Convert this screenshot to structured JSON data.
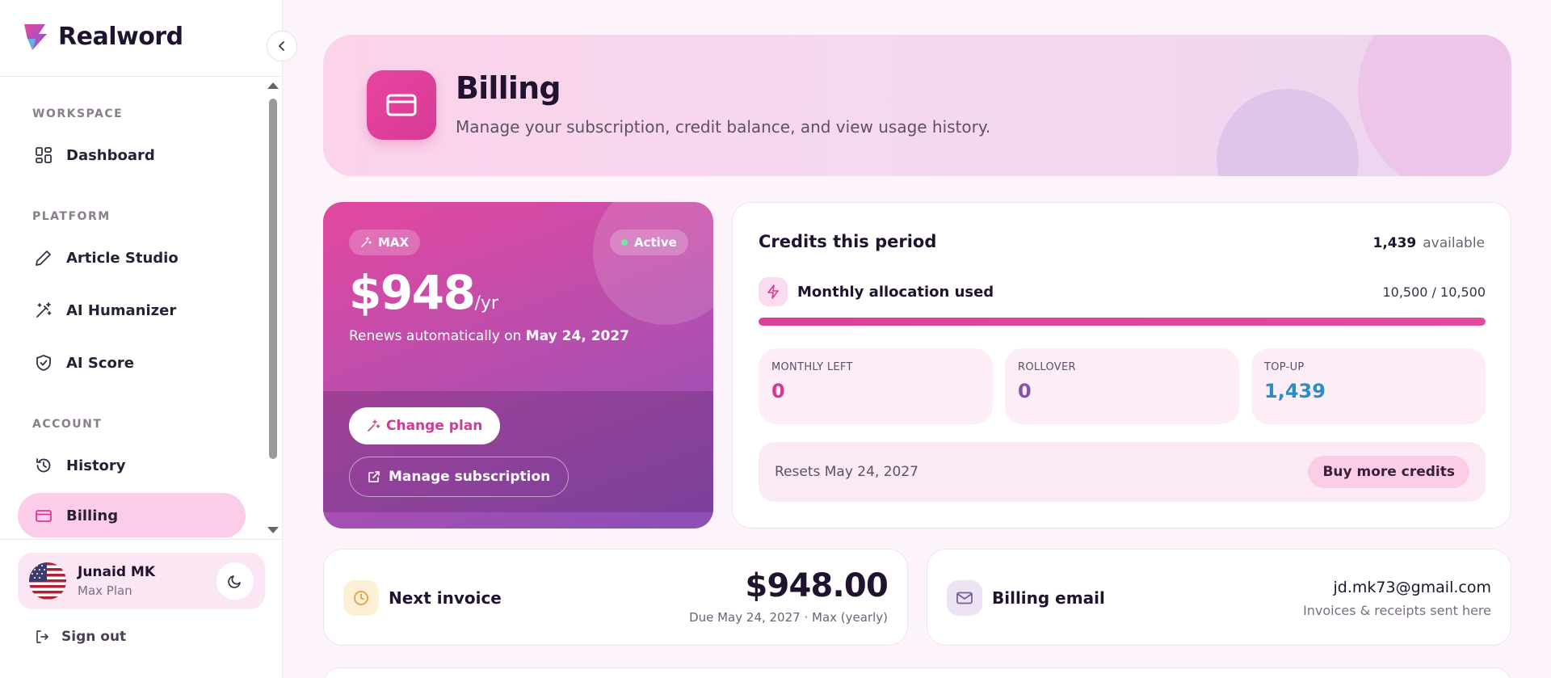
{
  "brand": {
    "name": "Realword"
  },
  "sidebar": {
    "sections": [
      {
        "label": "WORKSPACE"
      },
      {
        "label": "PLATFORM"
      },
      {
        "label": "ACCOUNT"
      }
    ],
    "items": [
      {
        "label": "Dashboard",
        "icon": "grid-icon",
        "active": false
      },
      {
        "label": "Article Studio",
        "icon": "pen-icon",
        "active": false
      },
      {
        "label": "AI Humanizer",
        "icon": "magic-wand-icon",
        "active": false
      },
      {
        "label": "AI Score",
        "icon": "shield-check-icon",
        "active": false
      },
      {
        "label": "History",
        "icon": "history-icon",
        "active": false
      },
      {
        "label": "Billing",
        "icon": "credit-card-icon",
        "active": true
      }
    ],
    "user": {
      "name": "Junaid MK",
      "plan": "Max Plan"
    },
    "signout_label": "Sign out"
  },
  "hero": {
    "title": "Billing",
    "subtitle": "Manage your subscription, credit balance, and view usage history."
  },
  "plan": {
    "badge": "MAX",
    "status": "Active",
    "price": "$948",
    "period": "/yr",
    "renew_prefix": "Renews automatically on ",
    "renew_date": "May 24, 2027",
    "change_label": "Change plan",
    "manage_label": "Manage subscription"
  },
  "credits": {
    "title": "Credits this period",
    "available_value": "1,439",
    "available_label": "available",
    "allocation_label": "Monthly allocation used",
    "allocation_value": "10,500 / 10,500",
    "allocation_used_fraction": 1.0,
    "stats": [
      {
        "label": "MONTHLY LEFT",
        "value": "0",
        "color": "#d23b93"
      },
      {
        "label": "ROLLOVER",
        "value": "0",
        "color": "#8a4fb0"
      },
      {
        "label": "TOP-UP",
        "value": "1,439",
        "color": "#2a8fc4"
      }
    ],
    "reset_text": "Resets May 24, 2027",
    "buy_label": "Buy more credits"
  },
  "invoice": {
    "label": "Next invoice",
    "amount": "$948.00",
    "sub": "Due May 24, 2027 · Max (yearly)"
  },
  "billing_email": {
    "label": "Billing email",
    "value": "jd.mk73@gmail.com",
    "sub": "Invoices & receipts sent here"
  },
  "colors": {
    "accent": "#d83a95",
    "accent_soft": "#fbcde8",
    "text": "#1f1330"
  }
}
